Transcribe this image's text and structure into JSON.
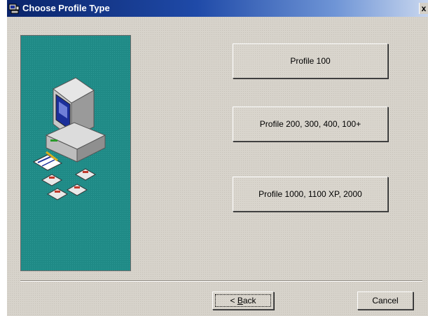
{
  "window": {
    "title": "Choose Profile Type",
    "close_label": "x",
    "title_icon": "wizard-app-icon"
  },
  "illustration": {
    "icon": "computer-with-disks-illustration",
    "panel_color": "#1f8a86"
  },
  "profiles": [
    {
      "label": "Profile 100"
    },
    {
      "label": "Profile 200, 300, 400, 100+"
    },
    {
      "label": "Profile 1000, 1100 XP, 2000"
    }
  ],
  "footer": {
    "back_prefix": "< ",
    "back_accel": "B",
    "back_rest": "ack",
    "cancel_label": "Cancel"
  },
  "colors": {
    "dialog_bg": "#d7d3cb",
    "titlebar_start": "#0a246a",
    "titlebar_end": "#c8d6ee"
  }
}
